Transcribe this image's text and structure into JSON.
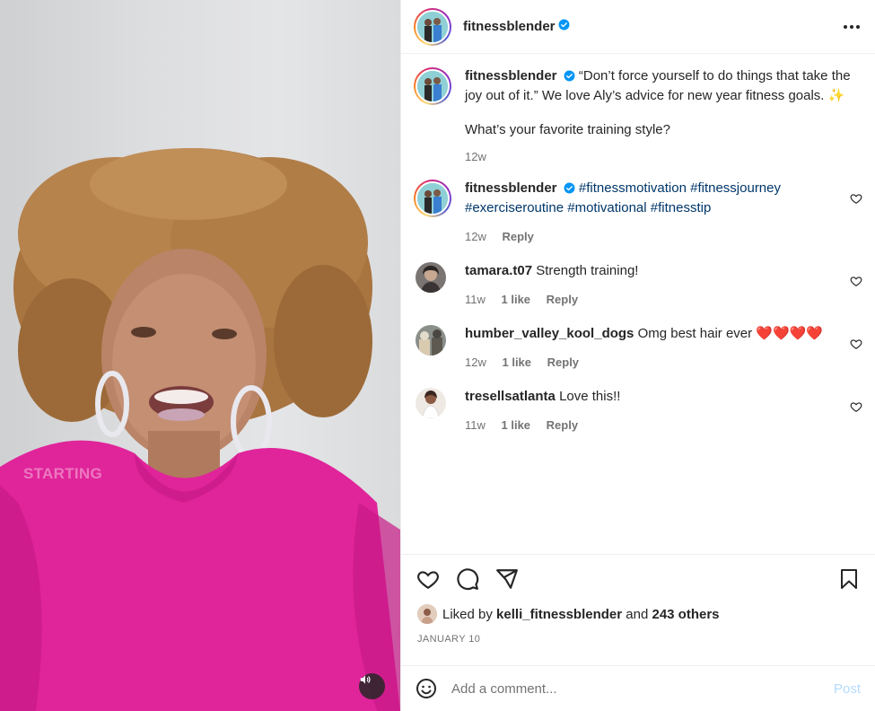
{
  "media": {
    "overlay_text": "STARTING"
  },
  "post": {
    "author": "fitnessblender",
    "caption_line1": "“Don’t force yourself to do things that take the",
    "caption_line2": "joy out of it.” We love Aly’s advice for new year fitness goals. ✨",
    "caption_line3": "What’s your favorite training style?",
    "caption_time": "12w"
  },
  "comments": [
    {
      "username": "fitnessblender",
      "tags_line1": "#fitnessmotivation #fitnessjourney",
      "tags_line2": "#exerciseroutine #motivational #fitnesstip",
      "time": "12w",
      "reply": "Reply"
    },
    {
      "username": "tamara.t07",
      "text": "Strength training!",
      "time": "11w",
      "likes": "1 like",
      "reply": "Reply"
    },
    {
      "username": "humber_valley_kool_dogs",
      "text": "Omg best hair ever ❤️❤️❤️❤️",
      "time": "12w",
      "likes": "1 like",
      "reply": "Reply"
    },
    {
      "username": "tresellsatlanta",
      "text": "Love this!!",
      "time": "11w",
      "likes": "1 like",
      "reply": "Reply"
    }
  ],
  "likes": {
    "prefix": "Liked by",
    "user": "kelli_fitnessblender",
    "and": "and",
    "others": "243 others"
  },
  "date": "JANUARY 10",
  "add_comment": {
    "placeholder": "Add a comment...",
    "post_label": "Post"
  },
  "icons": {
    "verified": "verified-badge-icon",
    "more": "more-options-icon",
    "like": "heart-icon",
    "comment": "comment-icon",
    "share": "share-icon",
    "save": "bookmark-icon",
    "emoji": "emoji-icon",
    "volume": "volume-icon"
  },
  "colors": {
    "verified_blue": "#0095f6",
    "link_blue": "#00376b",
    "post_disabled": "#b3dbff",
    "shirt_pink": "#e0249a"
  }
}
